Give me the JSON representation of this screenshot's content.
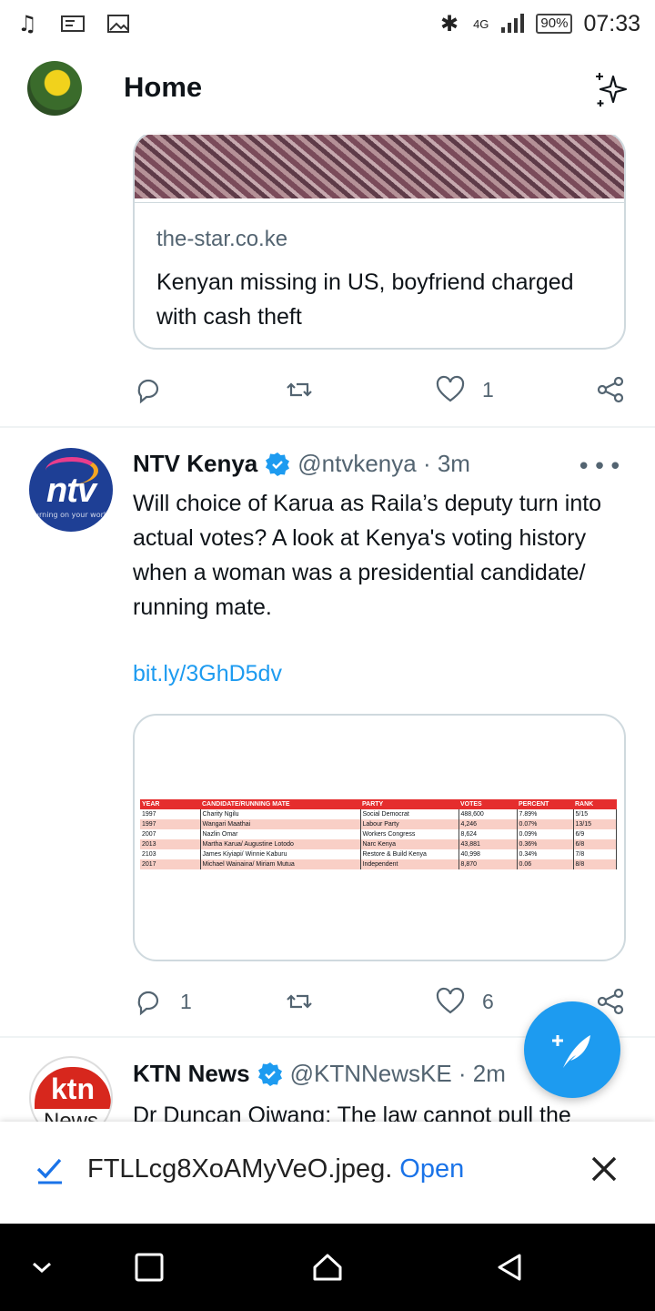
{
  "status_bar": {
    "network": "4G",
    "battery": "90%",
    "time": "07:33"
  },
  "header": {
    "title": "Home"
  },
  "previous_tweet": {
    "card": {
      "domain": "the-star.co.ke",
      "title": "Kenyan missing in US, boyfriend charged with cash theft"
    },
    "actions": {
      "replies": "",
      "retweets": "",
      "likes": "1"
    }
  },
  "tweet_ntv": {
    "name": "NTV Kenya",
    "handle": "@ntvkenya · 3m",
    "more": "•••",
    "avatar_logo": "ntv",
    "avatar_tagline": "turning on your world",
    "text": "Will choice of Karua as Raila’s deputy turn into actual votes? A look at Kenya's voting history when a woman was a presidential candidate/ running mate.",
    "link": "bit.ly/3GhD5dv",
    "table": {
      "headers": [
        "YEAR",
        "CANDIDATE/RUNNING MATE",
        "PARTY",
        "VOTES",
        "PERCENT",
        "RANK"
      ],
      "rows": [
        [
          "1997",
          "Charity Ngilu",
          "Social Democrat",
          "488,600",
          "7.89%",
          "5/15"
        ],
        [
          "1997",
          "Wangari Maathai",
          "Labour Party",
          "4,246",
          "0.07%",
          "13/15"
        ],
        [
          "2007",
          "Nazlin Omar",
          "Workers Congress",
          "8,624",
          "0.09%",
          "6/9"
        ],
        [
          "2013",
          "Martha Karua/ Augustine Lotodo",
          "Narc Kenya",
          "43,881",
          "0.36%",
          "6/8"
        ],
        [
          "2103",
          "James Kiyiapi/ Winnie Kaburu",
          "Restore & Build Kenya",
          "40,998",
          "0.34%",
          "7/8"
        ],
        [
          "2017",
          "Michael Wainaina/ Miriam Mutua",
          "Independent",
          "8,870",
          "0.06",
          "8/8"
        ]
      ]
    },
    "actions": {
      "replies": "1",
      "retweets": "",
      "likes": "6"
    }
  },
  "tweet_ktn": {
    "name": "KTN News",
    "handle": "@KTNNewsKE · 2m",
    "avatar_top": "ktn",
    "avatar_bottom": "News",
    "text": "Dr Duncan Ojwang: The law cannot pull the"
  },
  "download_bar": {
    "filename": "FTLLcg8XoAMyVeO.jpeg.",
    "open_label": "Open"
  },
  "colors": {
    "accent": "#1d9bf0",
    "table_header": "#e52d2d",
    "table_alt_row": "#f9cfc6"
  }
}
